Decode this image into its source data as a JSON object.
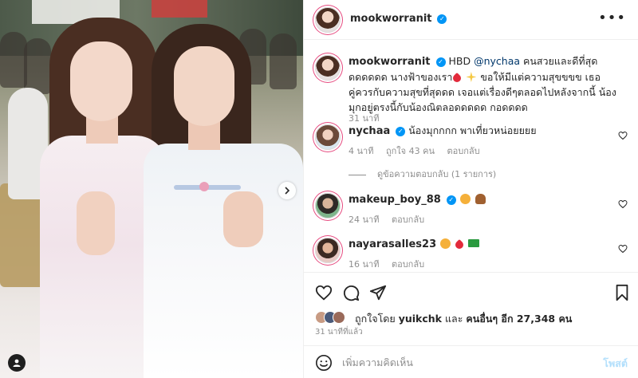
{
  "photo": {
    "alt": "",
    "next_icon": "chevron-right-icon",
    "tag_icon": "user-tag-icon"
  },
  "header": {
    "username": "mookworranit",
    "verified": true,
    "more_icon": "more-horizontal-icon"
  },
  "caption": {
    "username": "mookworranit",
    "prefix": "HBD",
    "mention": "@nychaa",
    "text_1": "คนสวยและดีที่สุดดดดดดด นางฟ้าของเรา",
    "text_2": "ขอให้มีแต่ความสุขขขข เธอคู่ควรกับความสุขที่สุดดด เจอแต่เรื่องดีๆตลอดไปหลังจากนี้ น้องมุกอยู่ตรงนี้กับน้องณิตลอดดดดด กอดดดด",
    "time": "31 นาที"
  },
  "comments": [
    {
      "username": "nychaa",
      "verified": true,
      "text": "น้องมุกกกก พาเที่ยวหน่อยยยย",
      "time": "4 นาที",
      "likes": "ถูกใจ 43 คน",
      "reply": "ตอบกลับ",
      "view_replies": "ดูข้อความตอบกลับ (1 รายการ)"
    },
    {
      "username": "makeup_boy_88",
      "verified": true,
      "text": "",
      "emojis": [
        "star-struck-emoji",
        "burger-emoji"
      ],
      "time": "24 นาที",
      "reply": "ตอบกลับ"
    },
    {
      "username": "nayarasalles23",
      "verified": false,
      "text": "",
      "emojis": [
        "star-struck-emoji",
        "red-heart-emoji",
        "brazil-flag-emoji"
      ],
      "time": "16 นาที",
      "reply": "ตอบกลับ"
    }
  ],
  "actions": {
    "like_icon": "heart-icon",
    "comment_icon": "comment-icon",
    "share_icon": "send-icon",
    "save_icon": "bookmark-icon"
  },
  "likes": {
    "prefix": "ถูกใจโดย",
    "first_liker": "yuikchk",
    "middle": "และ",
    "others": "คนอื่นๆ อีก 27,348 คน"
  },
  "timestamp": "31 นาทีที่แล้ว",
  "add_comment": {
    "emoji_icon": "emoji-smile-icon",
    "placeholder": "เพิ่มความคิดเห็น",
    "post_label": "โพสต์"
  },
  "colors": {
    "verified": "#0095f6",
    "link": "#00376b",
    "muted": "#8e8e8e",
    "post_disabled": "#b2dffc"
  }
}
